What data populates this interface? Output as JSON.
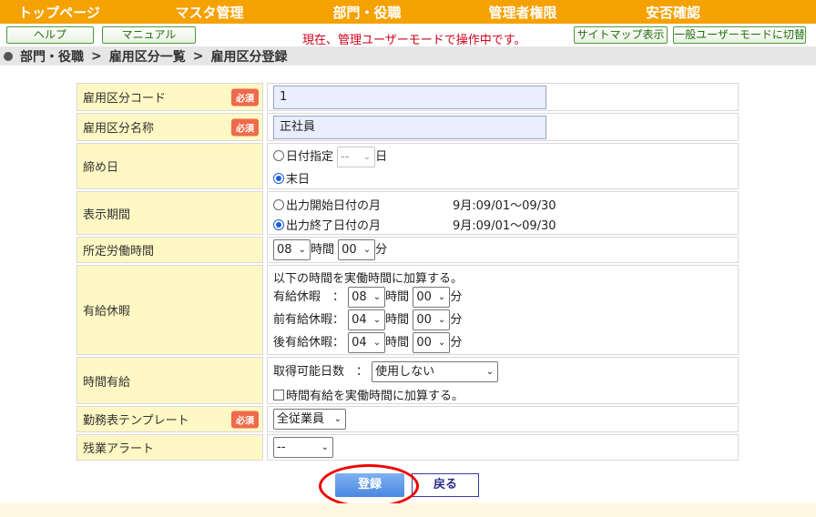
{
  "topnav": [
    "トップページ",
    "マスタ管理",
    "部門・役職",
    "管理者権限",
    "安否確認"
  ],
  "subbar": {
    "help": "ヘルプ",
    "manual": "マニュアル",
    "mode_message": "現在、管理ユーザーモードで操作中です。",
    "sitemap": "サイトマップ表示",
    "switch_mode": "一般ユーザーモードに切替"
  },
  "breadcrumb": [
    "部門・役職",
    "雇用区分一覧",
    "雇用区分登録"
  ],
  "breadcrumb_sep": ">",
  "required_badge": "必須",
  "fields": {
    "code": {
      "label": "雇用区分コード",
      "value": "1"
    },
    "name": {
      "label": "雇用区分名称",
      "value": "正社員"
    },
    "closing": {
      "label": "締め日",
      "opt_date": "日付指定",
      "date_value": "--",
      "day_suffix": "日",
      "opt_end": "末日"
    },
    "display_period": {
      "label": "表示期間",
      "opt_start": "出力開始日付の月",
      "start_range": "9月:09/01～09/30",
      "opt_end": "出力終了日付の月",
      "end_range": "9月:09/01～09/30"
    },
    "work_hours": {
      "label": "所定労働時間",
      "hours": "08",
      "hours_unit": "時間",
      "minutes": "00",
      "minutes_unit": "分"
    },
    "paid_leave": {
      "label": "有給休暇",
      "note": "以下の時間を実働時間に加算する。",
      "rows": [
        {
          "name": "有給休暇　：",
          "hours": "08",
          "minutes": "00"
        },
        {
          "name": "前有給休暇：",
          "hours": "04",
          "minutes": "00"
        },
        {
          "name": "後有給休暇：",
          "hours": "04",
          "minutes": "00"
        }
      ],
      "hours_unit": "時間",
      "minutes_unit": "分"
    },
    "hourly_leave": {
      "label": "時間有給",
      "days_label": "取得可能日数　：",
      "days_value": "使用しない",
      "checkbox_label": "時間有給を実働時間に加算する。"
    },
    "template": {
      "label": "勤務表テンプレート",
      "value": "全従業員"
    },
    "overtime": {
      "label": "残業アラート",
      "value": "--"
    }
  },
  "buttons": {
    "submit": "登録",
    "back": "戻る"
  },
  "colors": {
    "nav": "#f5a100",
    "label_bg": "#fff8c4",
    "required": "#ee6a4b",
    "mode_message": "#d0001a",
    "submit": "#4a87e0",
    "highlight_circle": "#e00000"
  }
}
